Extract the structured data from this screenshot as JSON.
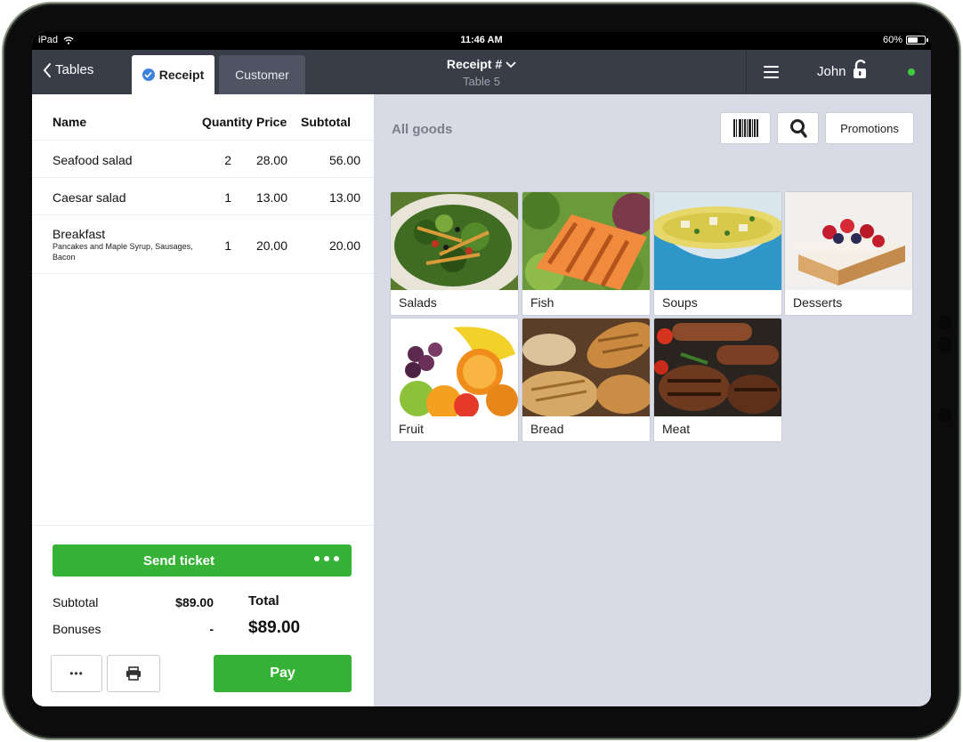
{
  "status_bar": {
    "device": "iPad",
    "time": "11:46 AM",
    "battery": "60%",
    "battery_level": 0.6
  },
  "nav": {
    "back_label": "Tables",
    "tab_receipt": "Receipt",
    "tab_customer": "Customer",
    "receipt_title": "Receipt #",
    "table_label": "Table 5",
    "user_name": "John"
  },
  "receipt": {
    "columns": {
      "name": "Name",
      "quantity": "Quantity",
      "price": "Price",
      "subtotal": "Subtotal"
    },
    "items": [
      {
        "name": "Seafood salad",
        "desc": "",
        "qty": "2",
        "price": "28.00",
        "subtotal": "56.00"
      },
      {
        "name": "Caesar salad",
        "desc": "",
        "qty": "1",
        "price": "13.00",
        "subtotal": "13.00"
      },
      {
        "name": "Breakfast",
        "desc": "Pancakes and Maple Syrup, Sausages, Bacon",
        "qty": "1",
        "price": "20.00",
        "subtotal": "20.00"
      }
    ],
    "send_ticket_label": "Send ticket",
    "subtotal_label": "Subtotal",
    "subtotal_value": "$89.00",
    "bonuses_label": "Bonuses",
    "bonuses_value": "-",
    "total_label": "Total",
    "total_value": "$89.00",
    "more_label": "•••",
    "pay_label": "Pay"
  },
  "goods": {
    "title": "All goods",
    "promotions_label": "Promotions",
    "categories": [
      {
        "label": "Salads",
        "image": "salad-photo"
      },
      {
        "label": "Fish",
        "image": "grilled-salmon-photo"
      },
      {
        "label": "Soups",
        "image": "soup-bowl-photo"
      },
      {
        "label": "Desserts",
        "image": "berry-cake-photo"
      },
      {
        "label": "Fruit",
        "image": "fruit-photo"
      },
      {
        "label": "Bread",
        "image": "bread-photo"
      },
      {
        "label": "Meat",
        "image": "grilled-meat-photo"
      }
    ]
  },
  "colors": {
    "accent_green": "#36b336",
    "nav_bg": "#383d48",
    "tab_inactive": "#4e5462",
    "goods_bg": "#d8dbe6",
    "check_blue": "#3d83db",
    "online": "#3ccd3c"
  }
}
